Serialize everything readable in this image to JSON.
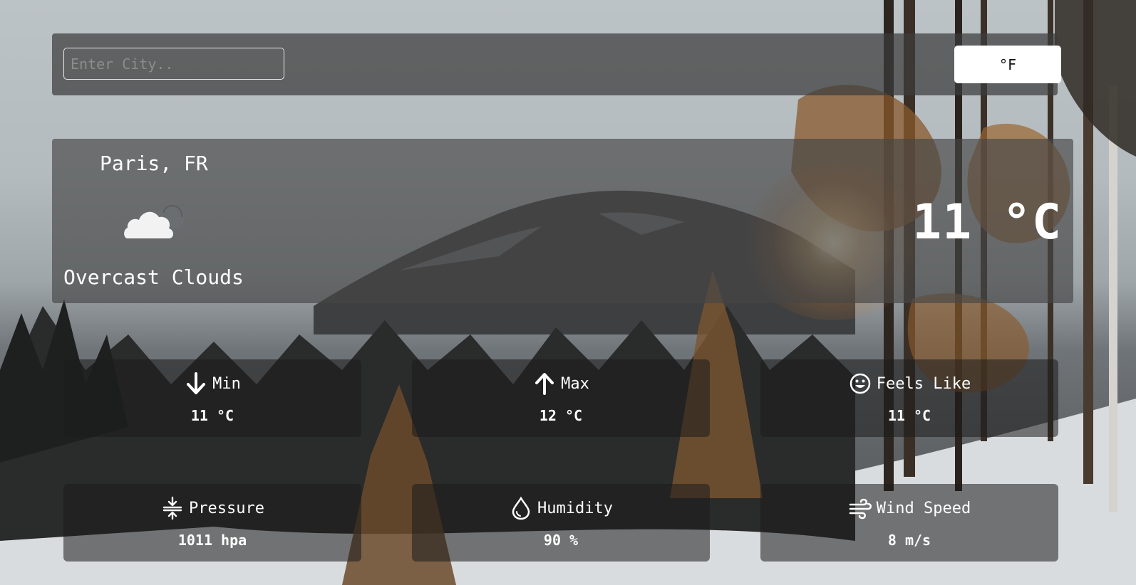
{
  "search": {
    "placeholder": "Enter City.."
  },
  "unit_toggle": {
    "label": "°F"
  },
  "current": {
    "location": "Paris, FR",
    "description": "Overcast Clouds",
    "temperature": "11 °C",
    "icon": "overcast-clouds-icon"
  },
  "stats": {
    "min": {
      "label": "Min",
      "value": "11 °C",
      "icon": "arrow-down-icon"
    },
    "max": {
      "label": "Max",
      "value": "12 °C",
      "icon": "arrow-up-icon"
    },
    "feels_like": {
      "label": "Feels Like",
      "value": "11 °C",
      "icon": "smiley-icon"
    },
    "pressure": {
      "label": "Pressure",
      "value": "1011 hpa",
      "icon": "compress-icon"
    },
    "humidity": {
      "label": "Humidity",
      "value": "90 %",
      "icon": "droplet-icon"
    },
    "wind_speed": {
      "label": "Wind Speed",
      "value": "8 m/s",
      "icon": "wind-icon"
    }
  },
  "colors": {
    "panel": "#3c3c3c",
    "button_bg": "#ffffff",
    "text": "#ffffff"
  }
}
